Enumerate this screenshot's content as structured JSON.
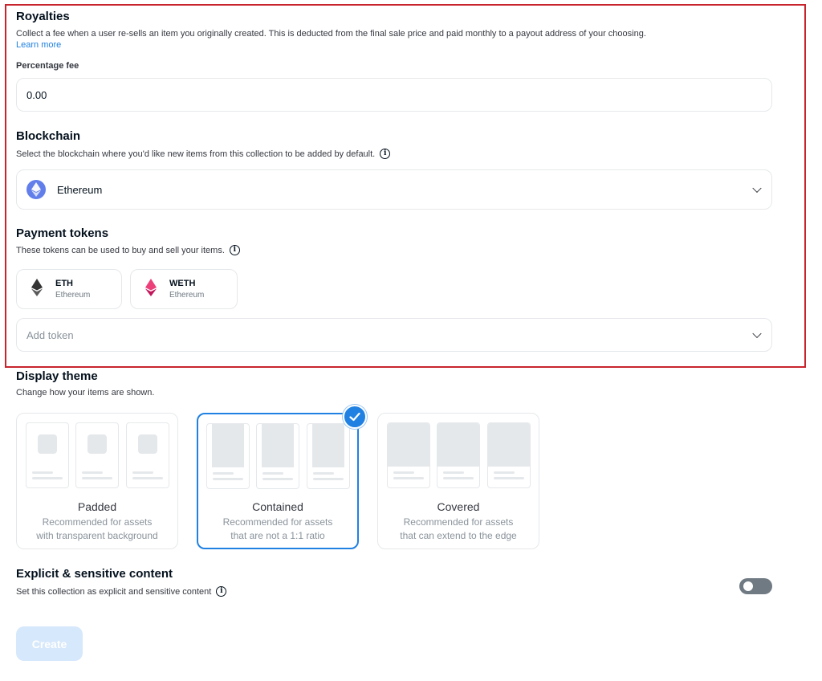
{
  "royalties": {
    "title": "Royalties",
    "description": "Collect a fee when a user re-sells an item you originally created. This is deducted from the final sale price and paid monthly to a payout address of your choosing.",
    "learn_more": "Learn more",
    "fee_label": "Percentage fee",
    "fee_value": "0.00"
  },
  "blockchain": {
    "title": "Blockchain",
    "description": "Select the blockchain where you'd like new items from this collection to be added by default.",
    "selected": "Ethereum",
    "selected_icon": "ethereum-icon"
  },
  "payment_tokens": {
    "title": "Payment tokens",
    "description": "These tokens can be used to buy and sell your items.",
    "tokens": [
      {
        "symbol": "ETH",
        "name": "Ethereum",
        "icon": "eth-icon",
        "color": "#343434"
      },
      {
        "symbol": "WETH",
        "name": "Ethereum",
        "icon": "weth-icon",
        "color": "#ec407a"
      }
    ],
    "add_placeholder": "Add token"
  },
  "display_theme": {
    "title": "Display theme",
    "description": "Change how your items are shown.",
    "options": [
      {
        "title": "Padded",
        "desc": "Recommended for assets\nwith transparent background",
        "selected": false
      },
      {
        "title": "Contained",
        "desc": "Recommended for assets\nthat are not a 1:1 ratio",
        "selected": true
      },
      {
        "title": "Covered",
        "desc": "Recommended for assets\nthat can extend to the edge",
        "selected": false
      }
    ]
  },
  "explicit": {
    "title": "Explicit & sensitive content",
    "description": "Set this collection as explicit and sensitive content",
    "enabled": false
  },
  "create_label": "Create",
  "colors": {
    "accent": "#2081e2",
    "highlight_border": "#c8242d",
    "border": "#e5e8eb"
  }
}
